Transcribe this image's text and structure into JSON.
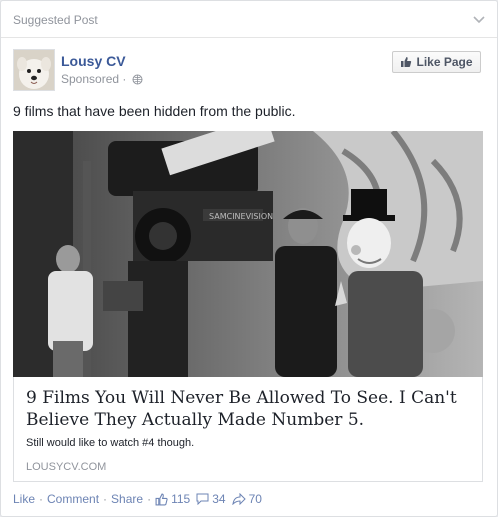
{
  "header": {
    "label": "Suggested Post",
    "menu_icon": "chevron-down-icon"
  },
  "page": {
    "name": "Lousy CV",
    "sponsored_label": "Sponsored",
    "separator": "·",
    "privacy_icon": "globe-icon",
    "like_button_label": "Like Page",
    "like_button_icon": "thumbs-up-icon"
  },
  "post": {
    "text": "9 films that have been hidden from the public."
  },
  "image": {
    "camera_text": "SAMCINEVISION"
  },
  "link": {
    "title": "9 Films You Will Never Be Allowed To See. I Can't Believe They Actually Made Number 5.",
    "summary": "Still would like to watch #4 though.",
    "domain": "LOUSYCV.COM"
  },
  "actions": {
    "like": "Like",
    "comment": "Comment",
    "share": "Share",
    "dot": "·",
    "likes_count": "115",
    "comments_count": "34",
    "shares_count": "70"
  },
  "colors": {
    "link_blue": "#3b5998",
    "meta_gray": "#90949c",
    "action_blue": "#6d84b4"
  }
}
